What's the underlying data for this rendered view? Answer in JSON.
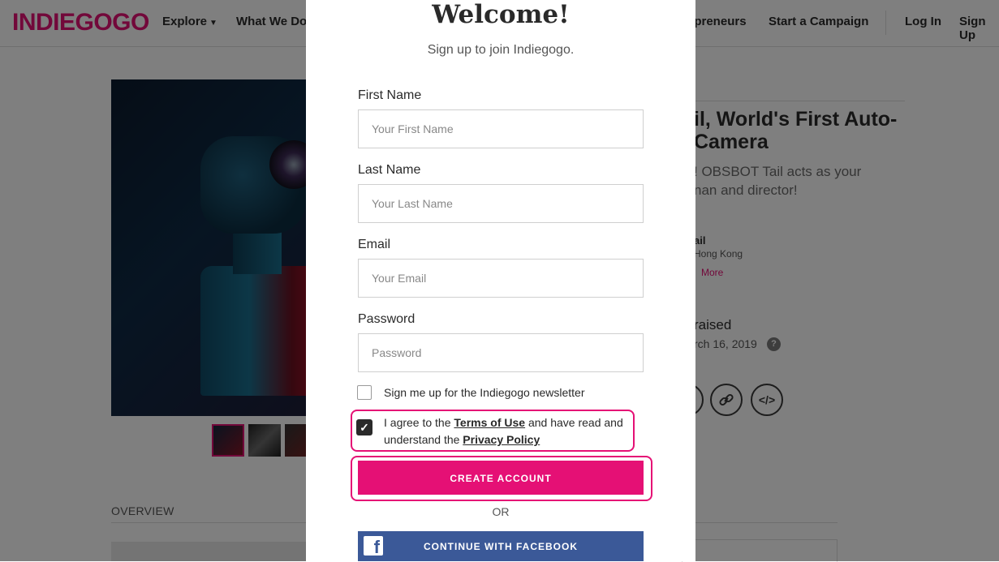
{
  "nav": {
    "logo": "INDIEGOGO",
    "explore": "Explore",
    "what_we_do": "What We Do",
    "entrepreneurs": "epreneurs",
    "start_campaign": "Start a Campaign",
    "log_in": "Log In",
    "sign_up": "Sign Up"
  },
  "campaign": {
    "title": "il, World's First Auto-\nCamera",
    "description": "! OBSBOT Tail acts as your\nnan and director!",
    "owner_name": "ail",
    "owner_location": "Hong Kong",
    "owner_more": "More",
    "raised": "raised",
    "date": "rch 16, 2019",
    "help": "?",
    "overview_tab": "OVERVIEW",
    "share_icons": [
      "facebook-icon",
      "link-icon",
      "embed-icon"
    ]
  },
  "modal": {
    "title": "Welcome!",
    "subtitle": "Sign up to join Indiegogo.",
    "first_name_label": "First Name",
    "first_name_placeholder": "Your First Name",
    "last_name_label": "Last Name",
    "last_name_placeholder": "Your Last Name",
    "email_label": "Email",
    "email_placeholder": "Your Email",
    "password_label": "Password",
    "password_placeholder": "Password",
    "newsletter_label": "Sign me up for the Indiegogo newsletter",
    "newsletter_checked": false,
    "terms_prefix": "I agree to the ",
    "terms_link": "Terms of Use",
    "terms_middle": " and have read and understand the ",
    "privacy_link": "Privacy Policy",
    "terms_checked": true,
    "create_account": "CREATE ACCOUNT",
    "or": "OR",
    "facebook": "CONTINUE WITH FACEBOOK"
  },
  "colors": {
    "brand": "#e51075",
    "facebook": "#3b5998",
    "overlay": "rgba(0,0,0,0.5)"
  }
}
